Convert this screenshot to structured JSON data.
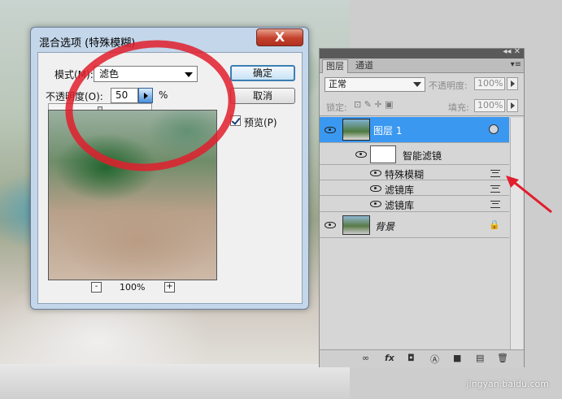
{
  "dialog": {
    "title": "混合选项 (特殊模糊)",
    "close_label": "X",
    "mode_label": "模式(M):",
    "mode_value": "滤色",
    "opacity_label": "不透明度(O):",
    "opacity_value": "50",
    "opacity_unit": "%",
    "opacity_slider_level": 0.5,
    "ok_label": "确定",
    "cancel_label": "取消",
    "preview_label": "预览(P)",
    "preview_checked": true,
    "zoom_out_label": "-",
    "zoom_in_label": "+",
    "zoom_level": "100%"
  },
  "layers_panel": {
    "topbar_glyphs": "◂◂ ✕",
    "tabs": [
      "图层",
      "通道"
    ],
    "menu_glyph": "▾≡",
    "blend_mode": "正常",
    "opacity_label": "不透明度:",
    "opacity_value": "100%",
    "lock_label": "锁定:",
    "fill_label": "填充:",
    "fill_value": "100%",
    "layers": [
      {
        "name": "图层 1",
        "selected": true
      },
      {
        "name": "智能滤镜",
        "selected": false
      }
    ],
    "filters": [
      "特殊模糊",
      "滤镜库",
      "滤镜库"
    ],
    "background_layer": "背景",
    "bottom_icons": [
      "∞",
      "fx",
      "◘",
      "Ⓐ",
      "■",
      "▤",
      "🗑"
    ]
  },
  "colors": {
    "accent_blue": "#3b98f0",
    "annotation_red": "#e11e2d"
  },
  "watermark": "jingyan.baidu.com"
}
